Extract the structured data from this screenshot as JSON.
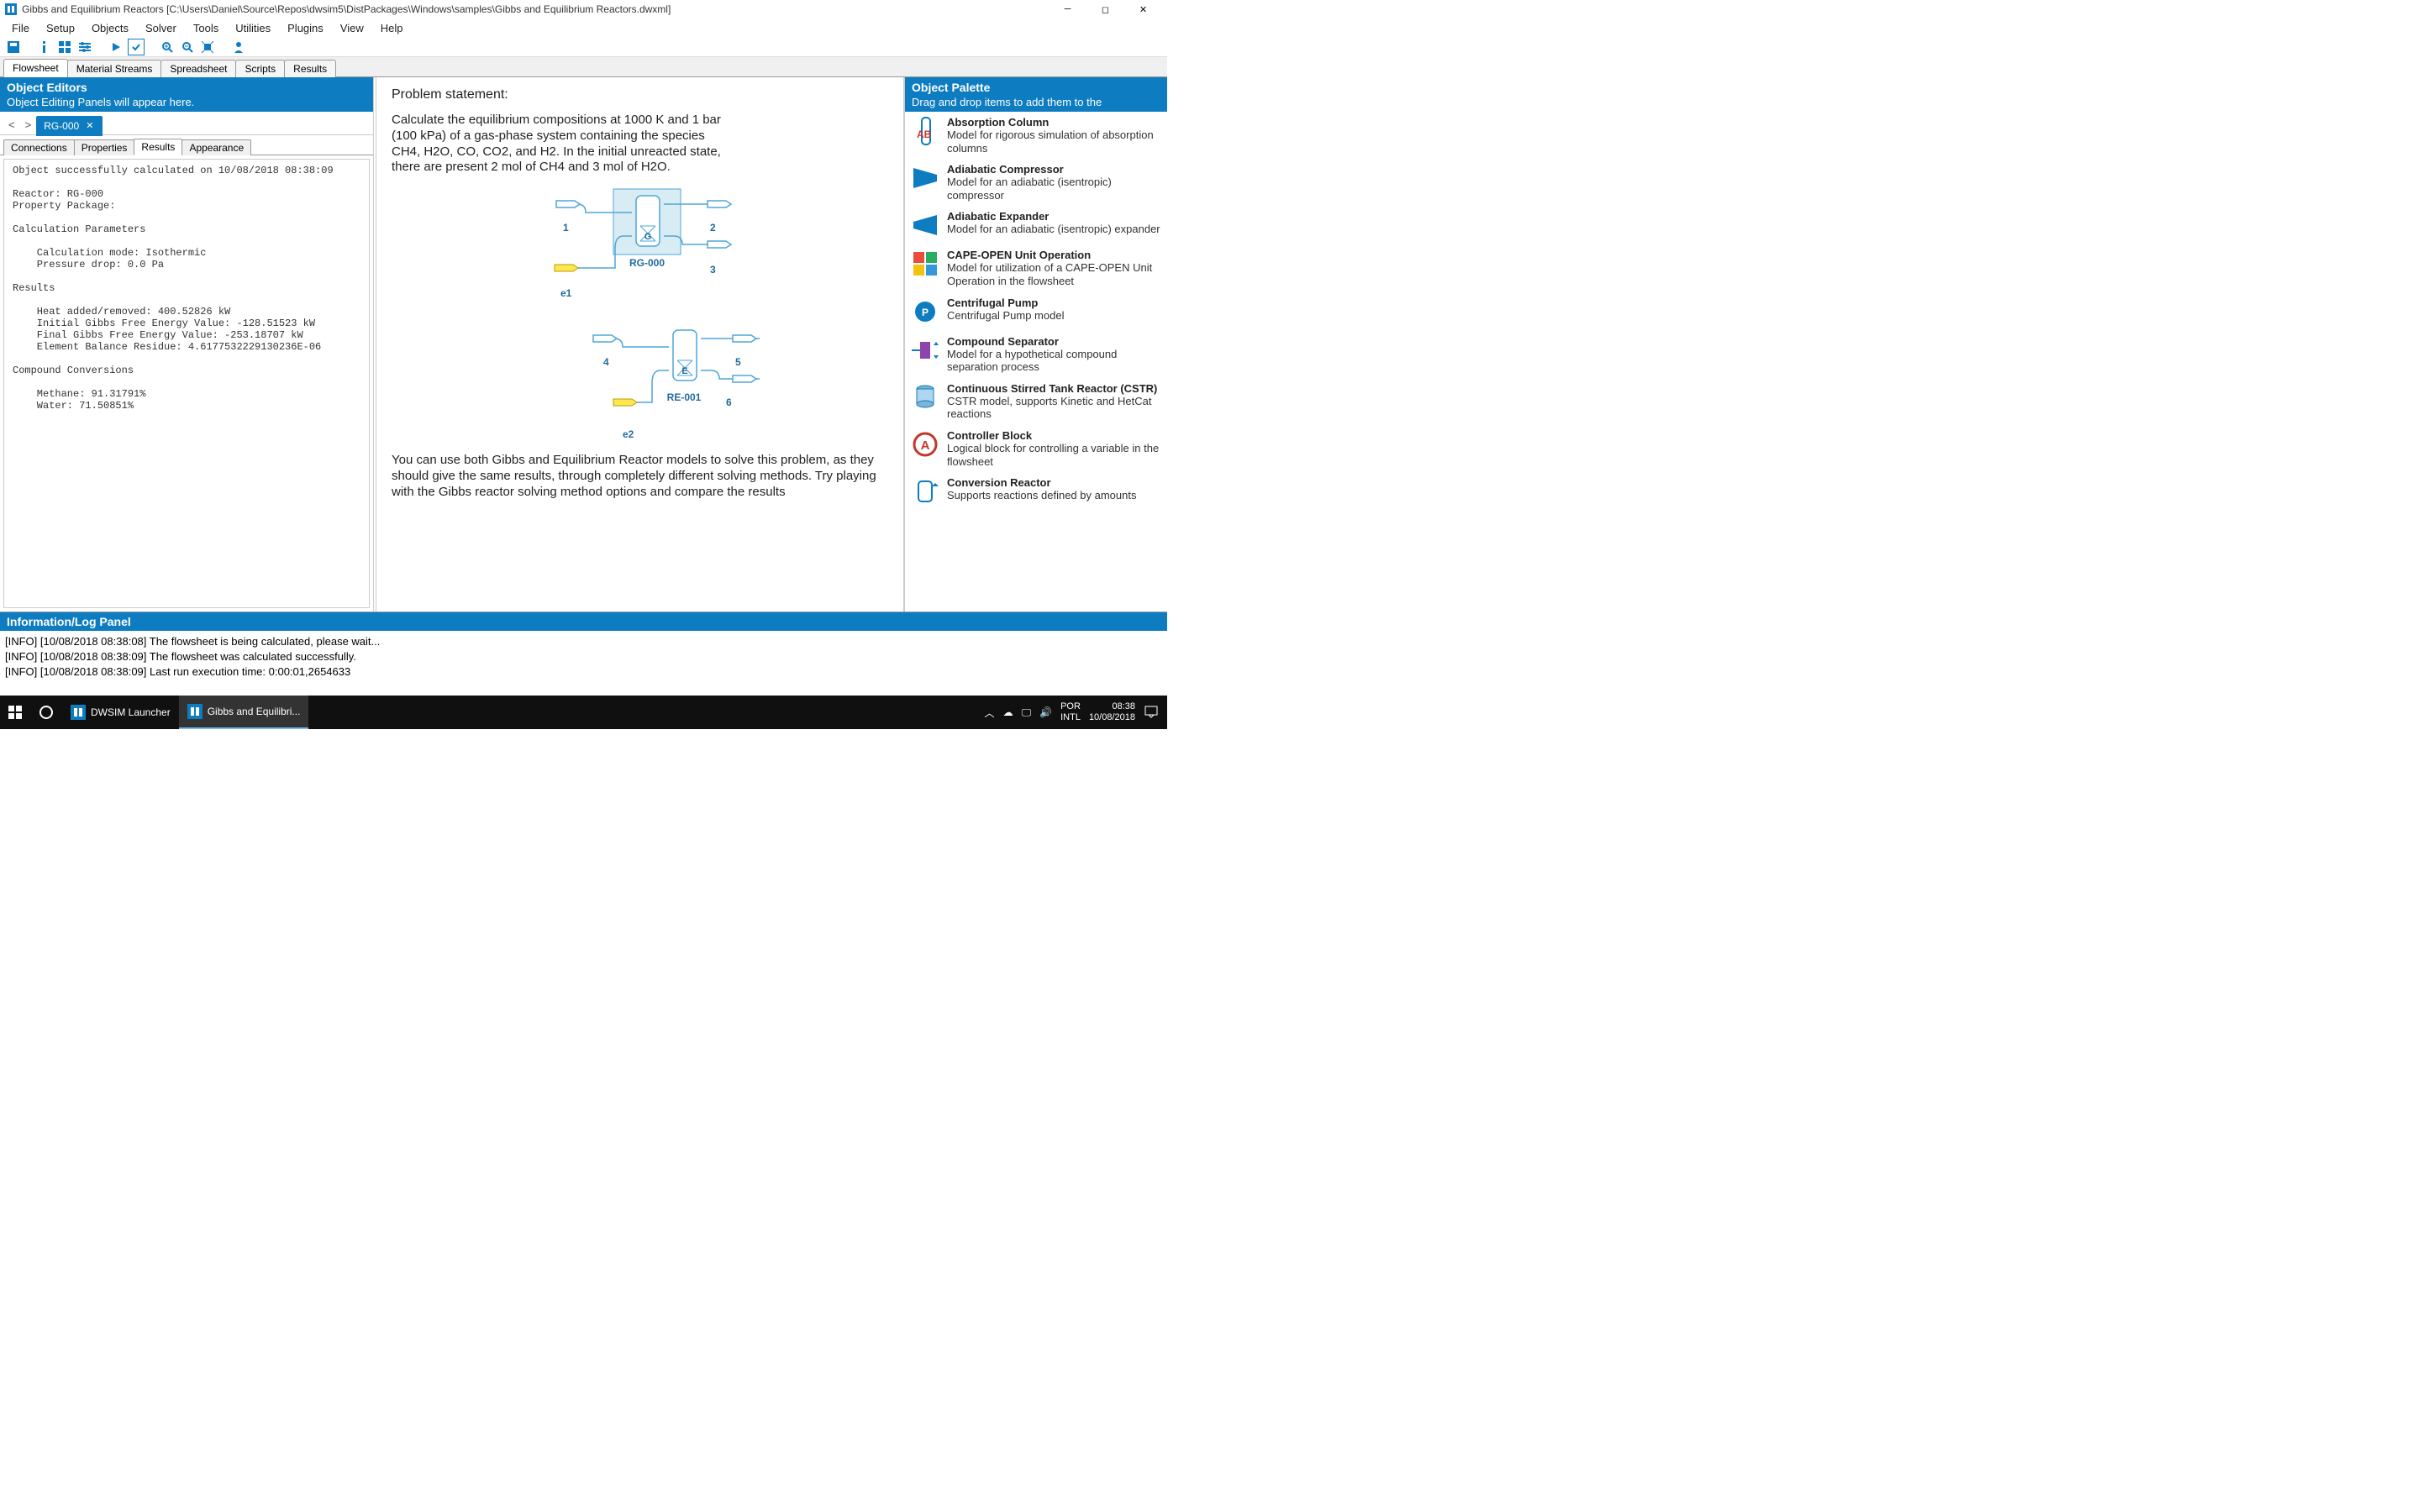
{
  "titlebar": {
    "title": "Gibbs and Equilibrium Reactors [C:\\Users\\Daniel\\Source\\Repos\\dwsim5\\DistPackages\\Windows\\samples\\Gibbs and Equilibrium Reactors.dwxml]"
  },
  "menu": [
    "File",
    "Setup",
    "Objects",
    "Solver",
    "Tools",
    "Utilities",
    "Plugins",
    "View",
    "Help"
  ],
  "doctabs": [
    "Flowsheet",
    "Material Streams",
    "Spreadsheet",
    "Scripts",
    "Results"
  ],
  "left_panel": {
    "header_title": "Object Editors",
    "header_sub": "Object Editing Panels will appear here.",
    "object_tab": "RG-000",
    "subtabs": [
      "Connections",
      "Properties",
      "Results",
      "Appearance"
    ],
    "results_text": "Object successfully calculated on 10/08/2018 08:38:09\n\nReactor: RG-000\nProperty Package: \n\nCalculation Parameters\n\n    Calculation mode: Isothermic\n    Pressure drop: 0.0 Pa\n\nResults\n\n    Heat added/removed: 400.52826 kW\n    Initial Gibbs Free Energy Value: -128.51523 kW\n    Final Gibbs Free Energy Value: -253.18707 kW\n    Element Balance Residue: 4.6177532229130236E-06\n\nCompound Conversions\n\n    Methane: 91.31791%\n    Water: 71.50851%"
  },
  "canvas": {
    "title": "Problem statement:",
    "para1": "Calculate the equilibrium compositions at 1000 K and 1 bar (100 kPa) of a gas-phase system containing the species CH4, H2O, CO, CO2, and H2. In the initial unreacted state, there are present 2 mol of CH4 and 3 mol of H2O.",
    "para2": "You can use both Gibbs and Equilibrium Reactor models to solve this problem, as they should give the same results, through completely different solving methods. Try playing with the Gibbs reactor solving method options and compare the results",
    "labels": {
      "r1": "RG-000",
      "r2": "RE-001",
      "s1": "1",
      "s2": "2",
      "s3": "3",
      "s4": "4",
      "s5": "5",
      "s6": "6",
      "e1": "e1",
      "e2": "e2"
    }
  },
  "palette": {
    "header_title": "Object Palette",
    "header_sub": "Drag and drop items to add them to the",
    "items": [
      {
        "title": "Absorption Column",
        "desc": "Model for rigorous simulation of absorption columns",
        "icon": "AB"
      },
      {
        "title": "Adiabatic Compressor",
        "desc": "Model for an adiabatic (isentropic) compressor",
        "icon": "COMP"
      },
      {
        "title": "Adiabatic Expander",
        "desc": "Model for an adiabatic (isentropic) expander",
        "icon": "EXP"
      },
      {
        "title": "CAPE-OPEN Unit Operation",
        "desc": "Model for utilization of a CAPE-OPEN Unit Operation in the flowsheet",
        "icon": "CO"
      },
      {
        "title": "Centrifugal Pump",
        "desc": "Centrifugal Pump model",
        "icon": "P"
      },
      {
        "title": "Compound Separator",
        "desc": "Model for a hypothetical compound separation process",
        "icon": "CS"
      },
      {
        "title": "Continuous Stirred Tank Reactor (CSTR)",
        "desc": "CSTR model, supports Kinetic and HetCat reactions",
        "icon": "CSTR"
      },
      {
        "title": "Controller Block",
        "desc": "Logical block for controlling a variable in the flowsheet",
        "icon": "A"
      },
      {
        "title": "Conversion Reactor",
        "desc": "Supports reactions defined by amounts",
        "icon": "CR"
      }
    ]
  },
  "log": {
    "header": "Information/Log Panel",
    "lines": [
      "[INFO] [10/08/2018 08:38:08] The flowsheet is being calculated, please wait...",
      "[INFO] [10/08/2018 08:38:09] The flowsheet was calculated successfully.",
      "[INFO] [10/08/2018 08:38:09] Last run execution time: 0:00:01,2654633"
    ]
  },
  "taskbar": {
    "app1": "DWSIM Launcher",
    "app2": "Gibbs and Equilibri...",
    "lang": "POR",
    "kb": "INTL",
    "time": "08:38",
    "date": "10/08/2018"
  }
}
